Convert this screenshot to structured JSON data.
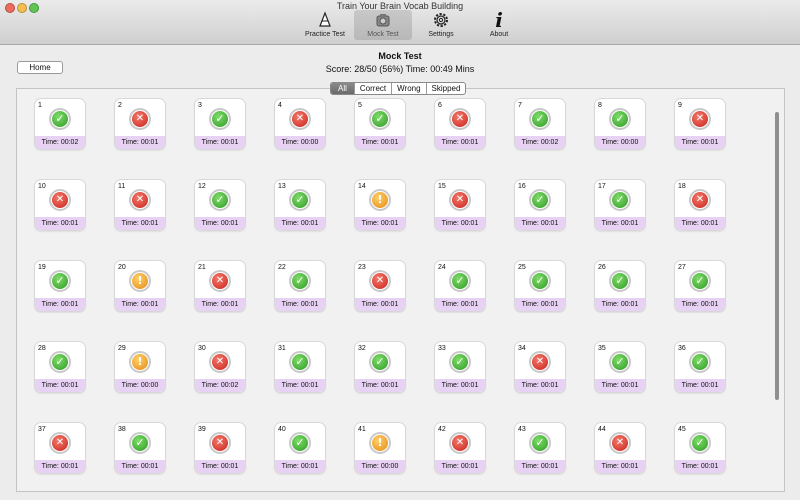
{
  "window": {
    "title": "Train Your Brain Vocab Building"
  },
  "toolbar": {
    "items": [
      {
        "label": "Practice Test",
        "icon": "practice-test-icon"
      },
      {
        "label": "Mock Test",
        "icon": "mock-test-icon"
      },
      {
        "label": "Settings",
        "icon": "gear-icon"
      },
      {
        "label": "About",
        "icon": "info-icon",
        "glyph": "i"
      }
    ]
  },
  "header": {
    "home_label": "Home",
    "title": "Mock Test",
    "score": "Score: 28/50 (56%) Time: 00:49 Mins"
  },
  "filters": [
    "All",
    "Correct",
    "Wrong",
    "Skipped"
  ],
  "colors": {
    "correct": "#3fae2f",
    "wrong": "#df3a2e",
    "skipped": "#f0a21d",
    "time_strip": "#e8d2f4"
  },
  "status_glyphs": {
    "correct": "✓",
    "wrong": "✕",
    "skipped": "!"
  },
  "questions": [
    {
      "num": "1",
      "status": "correct",
      "time": "Time: 00:02"
    },
    {
      "num": "2",
      "status": "wrong",
      "time": "Time: 00:01"
    },
    {
      "num": "3",
      "status": "correct",
      "time": "Time: 00:01"
    },
    {
      "num": "4",
      "status": "wrong",
      "time": "Time: 00:00"
    },
    {
      "num": "5",
      "status": "correct",
      "time": "Time: 00:01"
    },
    {
      "num": "6",
      "status": "wrong",
      "time": "Time: 00:01"
    },
    {
      "num": "7",
      "status": "correct",
      "time": "Time: 00:02"
    },
    {
      "num": "8",
      "status": "correct",
      "time": "Time: 00:00"
    },
    {
      "num": "9",
      "status": "wrong",
      "time": "Time: 00:01"
    },
    {
      "num": "10",
      "status": "wrong",
      "time": "Time: 00:01"
    },
    {
      "num": "11",
      "status": "wrong",
      "time": "Time: 00:01"
    },
    {
      "num": "12",
      "status": "correct",
      "time": "Time: 00:01"
    },
    {
      "num": "13",
      "status": "correct",
      "time": "Time: 00:01"
    },
    {
      "num": "14",
      "status": "skipped",
      "time": "Time: 00:01"
    },
    {
      "num": "15",
      "status": "wrong",
      "time": "Time: 00:01"
    },
    {
      "num": "16",
      "status": "correct",
      "time": "Time: 00:01"
    },
    {
      "num": "17",
      "status": "correct",
      "time": "Time: 00:01"
    },
    {
      "num": "18",
      "status": "wrong",
      "time": "Time: 00:01"
    },
    {
      "num": "19",
      "status": "correct",
      "time": "Time: 00:01"
    },
    {
      "num": "20",
      "status": "skipped",
      "time": "Time: 00:01"
    },
    {
      "num": "21",
      "status": "wrong",
      "time": "Time: 00:01"
    },
    {
      "num": "22",
      "status": "correct",
      "time": "Time: 00:01"
    },
    {
      "num": "23",
      "status": "wrong",
      "time": "Time: 00:01"
    },
    {
      "num": "24",
      "status": "correct",
      "time": "Time: 00:01"
    },
    {
      "num": "25",
      "status": "correct",
      "time": "Time: 00:01"
    },
    {
      "num": "26",
      "status": "correct",
      "time": "Time: 00:01"
    },
    {
      "num": "27",
      "status": "correct",
      "time": "Time: 00:01"
    },
    {
      "num": "28",
      "status": "correct",
      "time": "Time: 00:01"
    },
    {
      "num": "29",
      "status": "skipped",
      "time": "Time: 00:00"
    },
    {
      "num": "30",
      "status": "wrong",
      "time": "Time: 00:02"
    },
    {
      "num": "31",
      "status": "correct",
      "time": "Time: 00:01"
    },
    {
      "num": "32",
      "status": "correct",
      "time": "Time: 00:01"
    },
    {
      "num": "33",
      "status": "correct",
      "time": "Time: 00:01"
    },
    {
      "num": "34",
      "status": "wrong",
      "time": "Time: 00:01"
    },
    {
      "num": "35",
      "status": "correct",
      "time": "Time: 00:01"
    },
    {
      "num": "36",
      "status": "correct",
      "time": "Time: 00:01"
    },
    {
      "num": "37",
      "status": "wrong",
      "time": "Time: 00:01"
    },
    {
      "num": "38",
      "status": "correct",
      "time": "Time: 00:01"
    },
    {
      "num": "39",
      "status": "wrong",
      "time": "Time: 00:01"
    },
    {
      "num": "40",
      "status": "correct",
      "time": "Time: 00:01"
    },
    {
      "num": "41",
      "status": "skipped",
      "time": "Time: 00:00"
    },
    {
      "num": "42",
      "status": "wrong",
      "time": "Time: 00:01"
    },
    {
      "num": "43",
      "status": "correct",
      "time": "Time: 00:01"
    },
    {
      "num": "44",
      "status": "wrong",
      "time": "Time: 00:01"
    },
    {
      "num": "45",
      "status": "correct",
      "time": "Time: 00:01"
    }
  ]
}
